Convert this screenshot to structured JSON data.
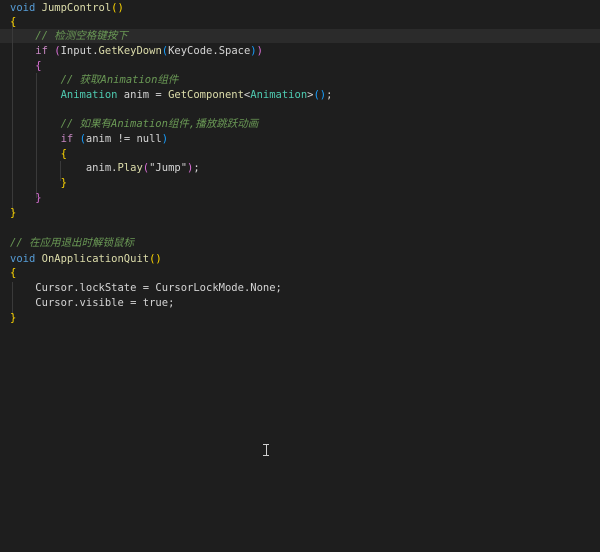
{
  "editor": {
    "lines": [
      [
        {
          "t": "void",
          "c": "kw"
        },
        {
          "t": " ",
          "c": "plain"
        },
        {
          "t": "JumpControl",
          "c": "fn"
        },
        {
          "t": "()",
          "c": "b1"
        }
      ],
      [
        {
          "t": "{",
          "c": "b1"
        }
      ],
      [
        {
          "t": "    ",
          "c": "plain"
        },
        {
          "t": "// 检测空格键按下",
          "c": "cm"
        }
      ],
      [
        {
          "t": "    ",
          "c": "plain"
        },
        {
          "t": "if",
          "c": "kw2"
        },
        {
          "t": " ",
          "c": "plain"
        },
        {
          "t": "(",
          "c": "b2"
        },
        {
          "t": "Input",
          "c": "plain"
        },
        {
          "t": ".",
          "c": "plain"
        },
        {
          "t": "GetKeyDown",
          "c": "fn"
        },
        {
          "t": "(",
          "c": "b3"
        },
        {
          "t": "KeyCode",
          "c": "plain"
        },
        {
          "t": ".",
          "c": "plain"
        },
        {
          "t": "Space",
          "c": "plain"
        },
        {
          "t": ")",
          "c": "b3"
        },
        {
          "t": ")",
          "c": "b2"
        }
      ],
      [
        {
          "t": "    ",
          "c": "plain"
        },
        {
          "t": "{",
          "c": "b2"
        }
      ],
      [
        {
          "t": "        ",
          "c": "plain"
        },
        {
          "t": "// 获取Animation组件",
          "c": "cm"
        }
      ],
      [
        {
          "t": "        ",
          "c": "plain"
        },
        {
          "t": "Animation",
          "c": "type"
        },
        {
          "t": " anim = ",
          "c": "plain"
        },
        {
          "t": "GetComponent",
          "c": "fn"
        },
        {
          "t": "<",
          "c": "plain"
        },
        {
          "t": "Animation",
          "c": "type"
        },
        {
          "t": ">",
          "c": "plain"
        },
        {
          "t": "()",
          "c": "b3"
        },
        {
          "t": ";",
          "c": "plain"
        }
      ],
      [],
      [
        {
          "t": "        ",
          "c": "plain"
        },
        {
          "t": "// 如果有Animation组件,播放跳跃动画",
          "c": "cm"
        }
      ],
      [
        {
          "t": "        ",
          "c": "plain"
        },
        {
          "t": "if",
          "c": "kw2"
        },
        {
          "t": " ",
          "c": "plain"
        },
        {
          "t": "(",
          "c": "b3"
        },
        {
          "t": "anim != ",
          "c": "plain"
        },
        {
          "t": "null",
          "c": "plain"
        },
        {
          "t": ")",
          "c": "b3"
        }
      ],
      [
        {
          "t": "        ",
          "c": "plain"
        },
        {
          "t": "{",
          "c": "b1"
        }
      ],
      [
        {
          "t": "            ",
          "c": "plain"
        },
        {
          "t": "anim",
          "c": "plain"
        },
        {
          "t": ".",
          "c": "plain"
        },
        {
          "t": "Play",
          "c": "fn"
        },
        {
          "t": "(",
          "c": "b2"
        },
        {
          "t": "\"Jump\"",
          "c": "plain"
        },
        {
          "t": ")",
          "c": "b2"
        },
        {
          "t": ";",
          "c": "plain"
        }
      ],
      [
        {
          "t": "        ",
          "c": "plain"
        },
        {
          "t": "}",
          "c": "b1"
        }
      ],
      [
        {
          "t": "    ",
          "c": "plain"
        },
        {
          "t": "}",
          "c": "b2"
        }
      ],
      [
        {
          "t": "}",
          "c": "b1"
        }
      ],
      [],
      [
        {
          "t": "// 在应用退出时解锁鼠标",
          "c": "cm"
        }
      ],
      [
        {
          "t": "void",
          "c": "kw"
        },
        {
          "t": " ",
          "c": "plain"
        },
        {
          "t": "OnApplicationQuit",
          "c": "fn"
        },
        {
          "t": "()",
          "c": "b1"
        }
      ],
      [
        {
          "t": "{",
          "c": "b1"
        }
      ],
      [
        {
          "t": "    ",
          "c": "plain"
        },
        {
          "t": "Cursor",
          "c": "plain"
        },
        {
          "t": ".lockState = ",
          "c": "plain"
        },
        {
          "t": "CursorLockMode",
          "c": "plain"
        },
        {
          "t": ".None;",
          "c": "plain"
        }
      ],
      [
        {
          "t": "    ",
          "c": "plain"
        },
        {
          "t": "Cursor",
          "c": "plain"
        },
        {
          "t": ".visible = ",
          "c": "plain"
        },
        {
          "t": "true",
          "c": "plain"
        },
        {
          "t": ";",
          "c": "plain"
        }
      ],
      [
        {
          "t": "}",
          "c": "b1"
        }
      ]
    ]
  },
  "colors": {
    "background": "#1e1e1e",
    "keyword": "#569cd6",
    "control_keyword": "#c586c0",
    "function": "#dcdcaa",
    "type": "#4ec9b0",
    "comment": "#6a9955",
    "text": "#d4d4d4",
    "bracket_1": "#ffd700",
    "bracket_2": "#da70d6",
    "bracket_3": "#179fff"
  }
}
